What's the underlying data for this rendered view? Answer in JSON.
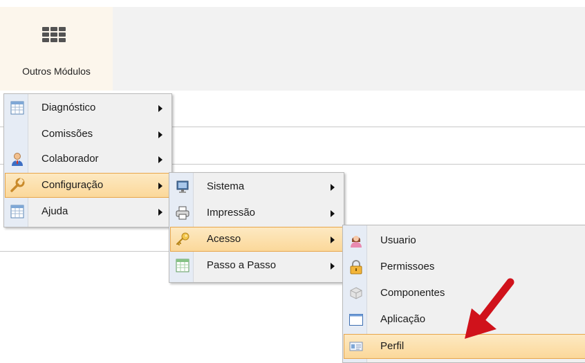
{
  "header": {
    "modules_label": "Outros Módulos"
  },
  "menu1": {
    "items": [
      {
        "label": "Diagnóstico",
        "icon": "table-icon"
      },
      {
        "label": "Comissões",
        "icon": ""
      },
      {
        "label": "Colaborador",
        "icon": "user-icon"
      },
      {
        "label": "Configuração",
        "icon": "wrench-icon",
        "highlighted": true
      },
      {
        "label": "Ajuda",
        "icon": "table-icon"
      }
    ]
  },
  "menu2": {
    "items": [
      {
        "label": "Sistema",
        "icon": "monitor-icon"
      },
      {
        "label": "Impressão",
        "icon": "printer-icon"
      },
      {
        "label": "Acesso",
        "icon": "key-icon",
        "highlighted": true
      },
      {
        "label": "Passo a Passo",
        "icon": "table-icon"
      }
    ]
  },
  "menu3": {
    "items": [
      {
        "label": "Usuario",
        "icon": "user-female-icon"
      },
      {
        "label": "Permissoes",
        "icon": "lock-icon"
      },
      {
        "label": "Componentes",
        "icon": "component-icon"
      },
      {
        "label": "Aplicação",
        "icon": "window-icon"
      },
      {
        "label": "Perfil",
        "icon": "id-card-icon",
        "highlighted": true
      }
    ]
  },
  "colors": {
    "highlight": "#fbd89a",
    "highlight_border": "#e7a54a",
    "arrow": "#d0121b"
  }
}
